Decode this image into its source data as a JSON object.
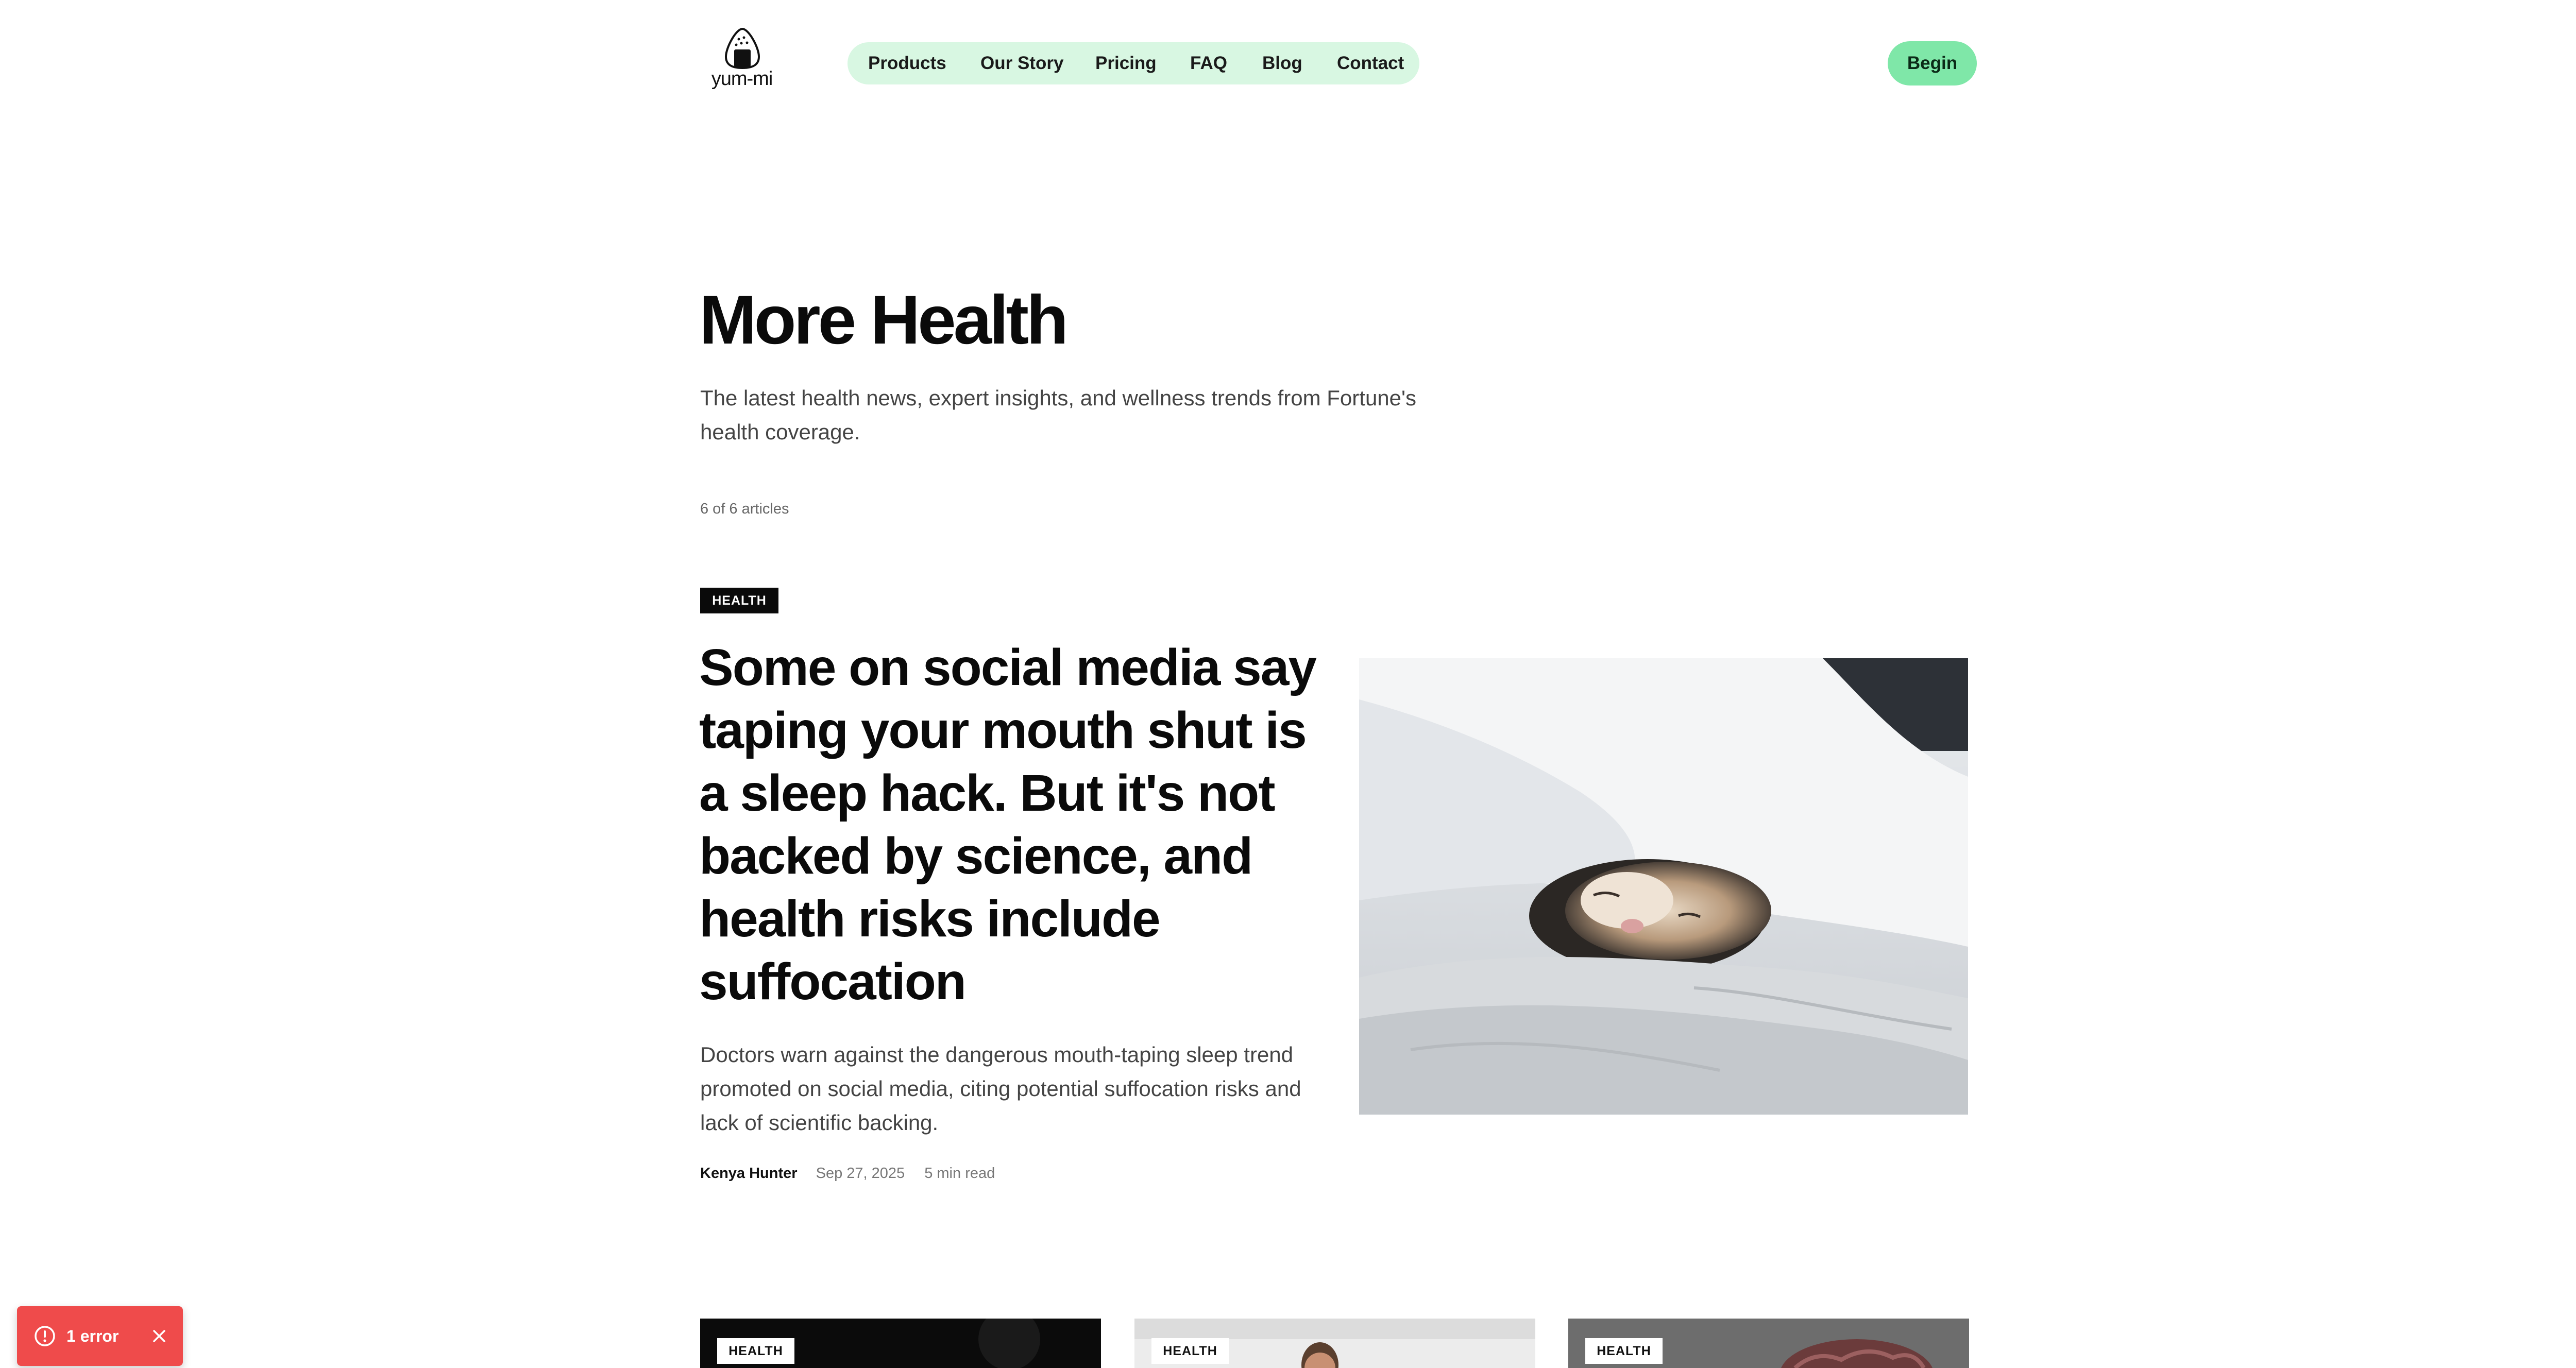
{
  "brand": {
    "name": "yum-mi"
  },
  "nav": {
    "items": [
      {
        "label": "Products"
      },
      {
        "label": "Our Story"
      },
      {
        "label": "Pricing"
      },
      {
        "label": "FAQ"
      },
      {
        "label": "Blog"
      },
      {
        "label": "Contact"
      }
    ],
    "begin_label": "Begin"
  },
  "page": {
    "title": "More Health",
    "description": "The latest health news, expert insights, and wellness trends from Fortune's health coverage.",
    "count_text": "6 of 6 articles"
  },
  "featured": {
    "tag": "HEALTH",
    "title": "Some on social media say taping your mouth shut is a sleep hack. But it's not backed by science, and health risks include suffocation",
    "description": "Doctors warn against the dangerous mouth-taping sleep trend promoted on social media, citing potential suffocation risks and lack of scientific backing.",
    "author": "Kenya Hunter",
    "date": "Sep 27, 2025",
    "read_time": "5 min read",
    "image_icon": "sleeping-cat-photo"
  },
  "cards": [
    {
      "tag": "HEALTH",
      "image_icon": "dark-photo"
    },
    {
      "tag": "HEALTH",
      "image_icon": "person-photo"
    },
    {
      "tag": "HEALTH",
      "image_icon": "brain-photo"
    }
  ],
  "error_toast": {
    "text": "1 error",
    "icon": "alert-circle-icon",
    "close_icon": "close-icon"
  },
  "colors": {
    "nav_bg": "#d8f7e2",
    "begin_bg": "#7fe7a8",
    "tag_bg": "#0a0a0a",
    "toast_bg": "#ef4b4b"
  }
}
